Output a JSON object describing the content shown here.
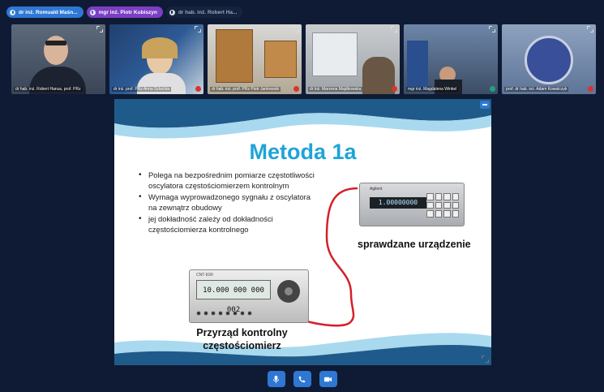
{
  "participants_bar": [
    {
      "name": "dr inż. Romuald Maśn...",
      "style": "blue"
    },
    {
      "name": "mgr inż. Piotr Kubiszyn",
      "style": "purple"
    },
    {
      "name": "dr hab. inż. Robert Ha...",
      "style": "dark"
    }
  ],
  "tiles": [
    {
      "label": "dr hab. inż. Robert Hanus, prof. PRz",
      "muted": false
    },
    {
      "label": "dr inż. prof. PRz Anna Szlachta",
      "muted": true
    },
    {
      "label": "dr hab. inż. prof. PRz Piotr Jankowski",
      "muted": true
    },
    {
      "label": "dr inż. Marzena Majdkowska",
      "muted": true
    },
    {
      "label": "mgr inż. Magdalena Winkel",
      "muted": false
    },
    {
      "label": "prof. dr hab. inż. Adam Kowalczyk",
      "muted": true
    }
  ],
  "slide": {
    "title": "Metoda 1a",
    "bullets": [
      "Polega na bezpośrednim pomiarze częstotliwości oscylatora częstościomierzem kontrolnym",
      "Wymaga wyprowadzonego sygnału z oscylatora na zewnątrz obudowy",
      "jej dokładność zależy od dokładności częstościomierza kontrolnego"
    ],
    "device_under_test_caption": "sprawdzane urządzenie",
    "reference_caption_line1": "Przyrząd kontrolny",
    "reference_caption_line2": "częstościomierz",
    "counter_display": "1.00000000",
    "reference_display": "10.000 000 000 002",
    "counter_brand": "Agilent",
    "reference_brand": "CNT-91R"
  },
  "controls": {
    "mic_icon": "microphone-icon",
    "hangup_icon": "phone-icon",
    "camera_icon": "camera-icon"
  },
  "colors": {
    "accent": "#2e78d4",
    "slide_title": "#1ea4d8",
    "cable": "#d4202a",
    "background": "#0f1b34"
  }
}
